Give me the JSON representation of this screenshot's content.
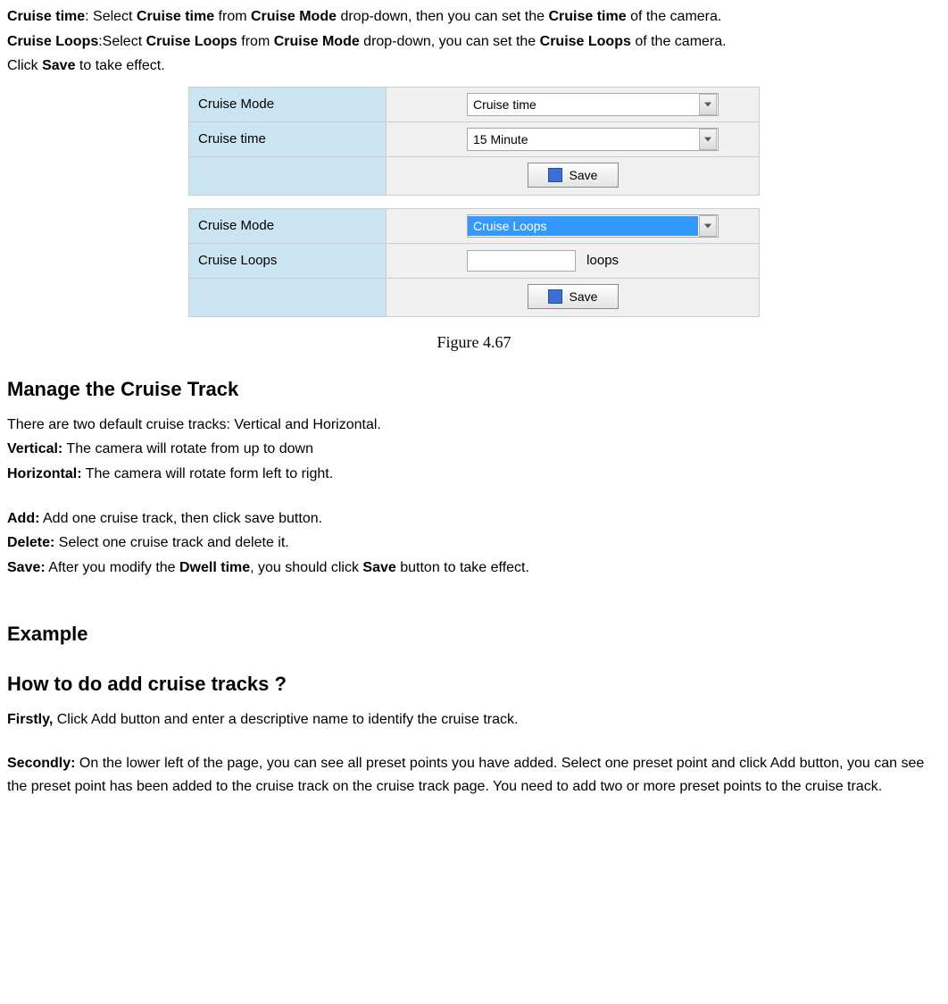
{
  "intro": {
    "cruise_time_term": "Cruise time",
    "cruise_time_text1": ": Select ",
    "cruise_time_term2": "Cruise time",
    "cruise_time_text2": " from ",
    "cruise_mode_term": "Cruise Mode",
    "cruise_time_text3": " drop-down, then you can set the ",
    "cruise_time_term3": "Cruise time",
    "cruise_time_text4": " of the camera.",
    "cruise_loops_term": "Cruise Loops",
    "cruise_loops_text1": ":Select ",
    "cruise_loops_term2": "Cruise Loops",
    "cruise_loops_text2": " from ",
    "cruise_mode_term2": "Cruise Mode",
    "cruise_loops_text3": " drop-down, you can set the ",
    "cruise_loops_term3": "Cruise Loops",
    "cruise_loops_text4": " of the camera.",
    "click_text1": "Click ",
    "save_term": "Save",
    "click_text2": " to take effect."
  },
  "panel1": {
    "row1_label": "Cruise Mode",
    "row1_value": "Cruise time",
    "row2_label": "Cruise time",
    "row2_value": "15 Minute",
    "save_label": "Save"
  },
  "panel2": {
    "row1_label": "Cruise Mode",
    "row1_value": "Cruise Loops",
    "row2_label": "Cruise Loops",
    "loops_suffix": "loops",
    "save_label": "Save"
  },
  "figure_caption": "Figure 4.67",
  "manage": {
    "heading": "Manage the Cruise Track",
    "intro": "There are two default cruise tracks: Vertical and Horizontal.",
    "vertical_term": "Vertical:",
    "vertical_text": " The camera will rotate from up to down",
    "horizontal_term": "Horizontal:",
    "horizontal_text": " The camera will rotate form left to right.",
    "add_term": "Add:",
    "add_text": " Add one cruise track, then click save button.",
    "delete_term": "Delete:",
    "delete_text": " Select one cruise track and delete it.",
    "save_term": "Save:",
    "save_text1": " After you modify the ",
    "dwell_term": "Dwell time",
    "save_text2": ", you should click ",
    "save_btn_term": "Save",
    "save_text3": " button to take effect."
  },
  "example": {
    "heading": "Example",
    "howto_heading": "How to do add cruise tracks ?",
    "first_term": "Firstly,",
    "first_text": " Click Add button and enter a descriptive name to identify the cruise track.",
    "second_term": "Secondly:",
    "second_text": " On the lower left of the page, you can see all preset points you have added. Select one preset point and click Add button, you can see the preset point has been added to the cruise track on the cruise track page. You need to add two or more preset points to the cruise track."
  }
}
